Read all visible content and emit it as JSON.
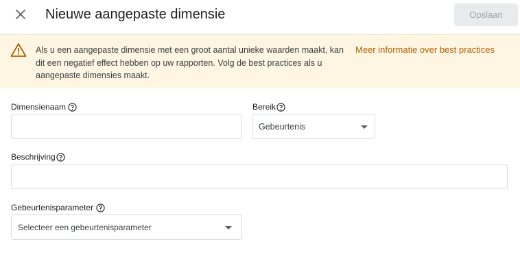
{
  "header": {
    "title": "Nieuwe aangepaste dimensie",
    "save_label": "Opslaan",
    "close_icon": "close-icon"
  },
  "banner": {
    "icon": "warning-icon",
    "text": "Als u een aangepaste dimensie met een groot aantal unieke waarden maakt, kan dit een negatief effect hebben op uw rapporten. Volg de best practices als u aangepaste dimensies maakt.",
    "link": "Meer informatie over best practices",
    "background": "#fef5e3",
    "link_color": "#b06000"
  },
  "form": {
    "dimension_name": {
      "label": "Dimensienaam",
      "value": ""
    },
    "scope": {
      "label": "Bereik",
      "value": "Gebeurtenis"
    },
    "description": {
      "label": "Beschrijving",
      "value": ""
    },
    "event_parameter": {
      "label": "Gebeurtenisparameter",
      "placeholder": "Selecteer een gebeurtenisparameter"
    }
  }
}
